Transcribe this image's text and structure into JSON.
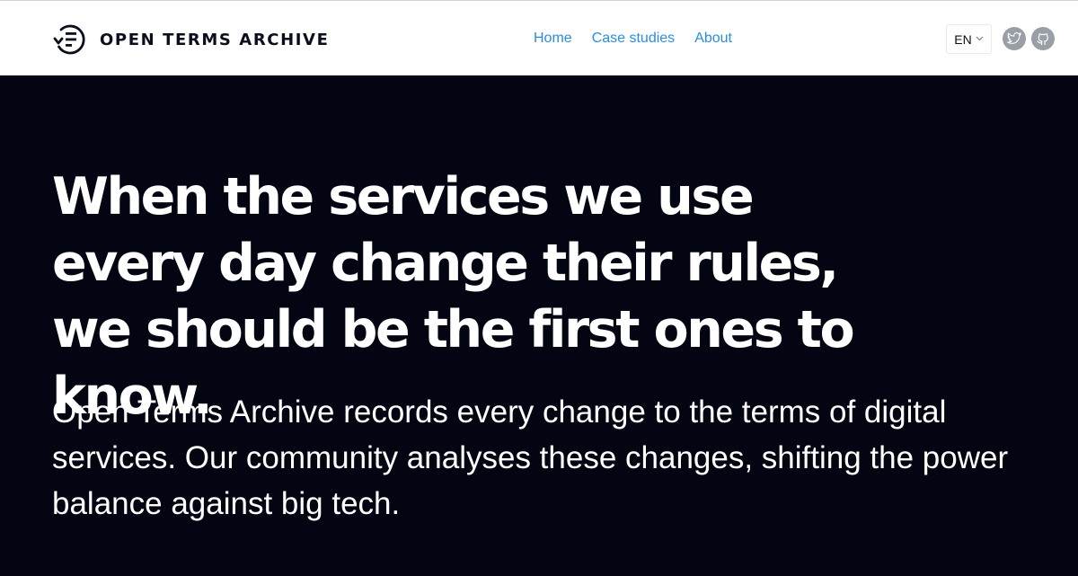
{
  "header": {
    "logo_text": "OPEN TERMS ARCHIVE",
    "logo_icon": "document-history-icon",
    "nav": [
      {
        "label": "Home"
      },
      {
        "label": "Case studies"
      },
      {
        "label": "About"
      }
    ],
    "language": {
      "selected": "EN",
      "icon": "chevron-down-icon"
    },
    "social": [
      {
        "icon": "twitter-icon"
      },
      {
        "icon": "github-icon"
      }
    ]
  },
  "hero": {
    "title": "When the services we use every day change their rules, we should be the first ones to know.",
    "subtitle": "Open Terms Archive records every change to the terms of digital services. Our community analyses these changes, shifting the power balance against big tech."
  },
  "colors": {
    "hero_background": "#030612",
    "nav_link": "#2a8ddf",
    "header_background": "#ffffff",
    "social_icon_background": "#999ea7",
    "text_dark": "#0b0f1d"
  }
}
